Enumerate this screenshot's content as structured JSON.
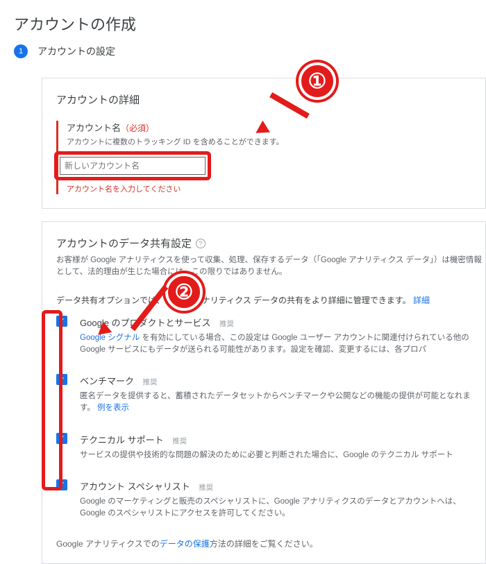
{
  "page_title": "アカウントの作成",
  "step": {
    "number": "1",
    "label": "アカウントの設定"
  },
  "details_panel": {
    "title": "アカウントの詳細",
    "account_name_label": "アカウント名",
    "required_suffix": "（必須）",
    "account_name_help": "アカウントに複数のトラッキング ID を含めることができます。",
    "account_name_placeholder": "新しいアカウント名",
    "account_name_error": "アカウント名を入力してください"
  },
  "sharing_panel": {
    "title": "アカウントのデータ共有設定",
    "desc": "お客様が Google アナリティクスを使って収集、処理、保存するデータ（「Google アナリティクス データ」）は機密情報として、法的理由が生じた場合には、この限りではありません。",
    "intro_prefix": "データ共有オプションでは、Google アナリティクス データの共有をより詳細に管理できます。",
    "intro_link": "詳細",
    "checkboxes": [
      {
        "title": "Google のプロダクトとサービス",
        "reco": "推奨",
        "desc_prefix": "Google シグナル",
        "desc_rest": " を有効にしている場合、この設定は Google ユーザー アカウントに関連付けられている他の Google サービスにもデータが送られる可能性があります。設定を確認、変更するには、各プロパ"
      },
      {
        "title": "ベンチマーク",
        "reco": "推奨",
        "desc": "匿名データを提供すると、蓄積されたデータセットからベンチマークや公開などの機能の提供が可能となれます。",
        "desc_link": "例を表示"
      },
      {
        "title": "テクニカル サポート",
        "reco": "推奨",
        "desc": "サービスの提供や技術的な問題の解決のために必要と判断された場合に、Google のテクニカル サポート"
      },
      {
        "title": "アカウント スペシャリスト",
        "reco": "推奨",
        "desc": "Google のマーケティングと販売のスペシャリストに、Google アナリティクスのデータとアカウントへは、Google のスペシャリストにアクセスを許可してください。"
      }
    ],
    "footer_prefix": "Google アナリティクスでの",
    "footer_link": "データの保護",
    "footer_suffix": "方法の詳細をご覧ください。"
  },
  "annotations": {
    "badge1": "①",
    "badge2": "②"
  }
}
